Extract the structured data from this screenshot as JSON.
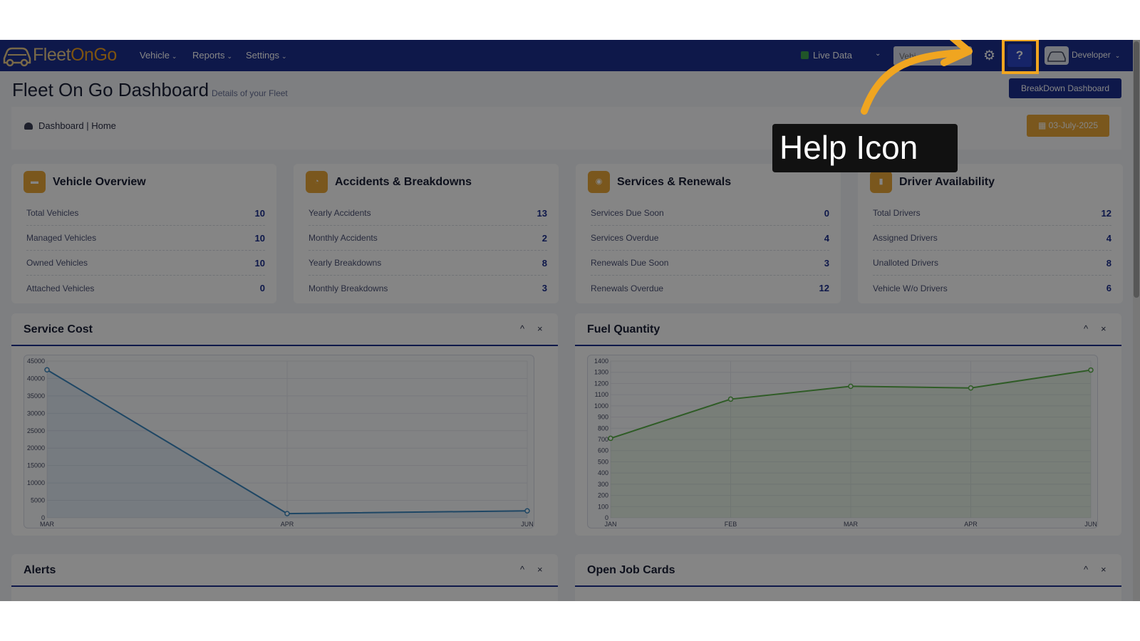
{
  "brand": {
    "logo_plain": "Fleet",
    "logo_highlight": "OnGo"
  },
  "nav": {
    "items": [
      {
        "label": "Vehicle"
      },
      {
        "label": "Reports"
      },
      {
        "label": "Settings"
      }
    ]
  },
  "topbar": {
    "live_data_label": "Live Data",
    "vehicle_search_placeholder": "Vehi",
    "help_label": "?",
    "user_label": "Developer"
  },
  "page": {
    "title": "Fleet On Go Dashboard",
    "subtitle": "Details of your Fleet",
    "breakdown_button": "BreakDown Dashboard",
    "breadcrumb": "Dashboard | Home",
    "date": "03-July-2025"
  },
  "cards": [
    {
      "title": "Vehicle Overview",
      "rows": [
        {
          "label": "Total Vehicles",
          "value": "10"
        },
        {
          "label": "Managed Vehicles",
          "value": "10"
        },
        {
          "label": "Owned Vehicles",
          "value": "10"
        },
        {
          "label": "Attached Vehicles",
          "value": "0"
        }
      ]
    },
    {
      "title": "Accidents & Breakdowns",
      "rows": [
        {
          "label": "Yearly Accidents",
          "value": "13"
        },
        {
          "label": "Monthly Accidents",
          "value": "2"
        },
        {
          "label": "Yearly Breakdowns",
          "value": "8"
        },
        {
          "label": "Monthly Breakdowns",
          "value": "3"
        }
      ]
    },
    {
      "title": "Services & Renewals",
      "rows": [
        {
          "label": "Services Due Soon",
          "value": "0"
        },
        {
          "label": "Services Overdue",
          "value": "4"
        },
        {
          "label": "Renewals Due Soon",
          "value": "3"
        },
        {
          "label": "Renewals Overdue",
          "value": "12"
        }
      ]
    },
    {
      "title": "Driver Availability",
      "rows": [
        {
          "label": "Total Drivers",
          "value": "12"
        },
        {
          "label": "Assigned Drivers",
          "value": "4"
        },
        {
          "label": "Unalloted Drivers",
          "value": "8"
        },
        {
          "label": "Vehicle W/o Drivers",
          "value": "6"
        }
      ]
    }
  ],
  "panels": {
    "service_cost": "Service Cost",
    "fuel_quantity": "Fuel Quantity",
    "alerts": "Alerts",
    "open_job_cards": "Open Job Cards",
    "collapse_glyph": "^",
    "close_glyph": "×"
  },
  "annotation": {
    "label": "Help Icon",
    "color": "#f0a520"
  },
  "colors": {
    "navbar": "#1b2e8f",
    "accent": "#eaa838",
    "service_line": "#3a87c0",
    "fuel_line": "#5ab04a"
  },
  "chart_data": [
    {
      "type": "area",
      "title": "Service Cost",
      "x": [
        "MAR",
        "APR",
        "JUN"
      ],
      "series": [
        {
          "values": [
            42500,
            1200,
            2000
          ]
        }
      ],
      "ylim": [
        0,
        45000
      ],
      "yticks": [
        0,
        5000,
        10000,
        15000,
        20000,
        25000,
        30000,
        35000,
        40000,
        45000
      ],
      "grid": true
    },
    {
      "type": "area",
      "title": "Fuel Quantity",
      "x": [
        "JAN",
        "FEB",
        "MAR",
        "APR",
        "JUN"
      ],
      "series": [
        {
          "values": [
            710,
            1060,
            1175,
            1160,
            1320
          ]
        }
      ],
      "ylim": [
        0,
        1400
      ],
      "yticks": [
        0,
        100,
        200,
        300,
        400,
        500,
        600,
        700,
        800,
        900,
        1000,
        1100,
        1200,
        1300,
        1400
      ],
      "grid": true
    }
  ]
}
